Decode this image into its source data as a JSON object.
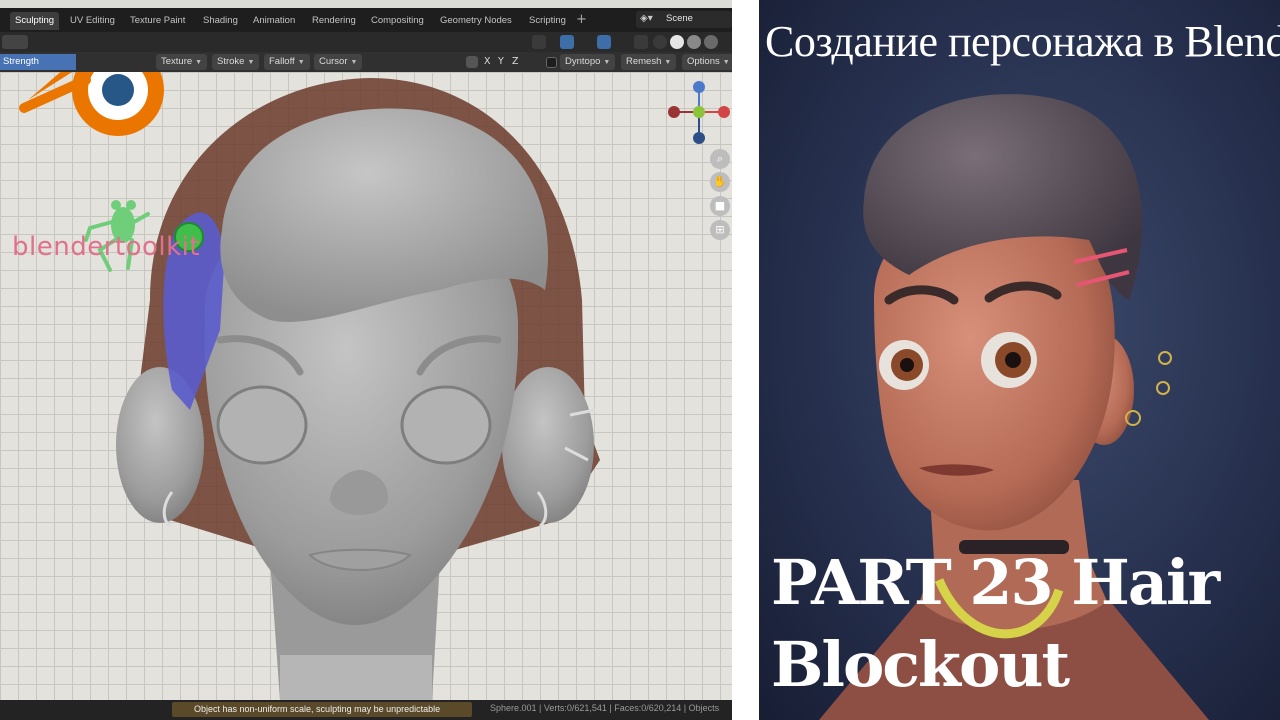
{
  "workspace_tabs": [
    "Sculpting",
    "UV Editing",
    "Texture Paint",
    "Shading",
    "Animation",
    "Rendering",
    "Compositing",
    "Geometry Nodes",
    "Scripting"
  ],
  "active_tab": "Sculpting",
  "scene_label": "Scene",
  "toolbar": {
    "strength_label": "Strength",
    "texture_label": "Texture",
    "stroke_label": "Stroke",
    "falloff_label": "Falloff",
    "cursor_label": "Cursor",
    "axis_x": "X",
    "axis_y": "Y",
    "axis_z": "Z",
    "dyntopo_label": "Dyntopo",
    "remesh_label": "Remesh",
    "options_label": "Options"
  },
  "gizmo": {
    "x": "X",
    "y": "Y",
    "z": "Z"
  },
  "watermark": "blendertoolkit",
  "status": {
    "warning": "Object has non-uniform scale, sculpting may be unpredictable",
    "stats": "Sphere.001 | Verts:0/621,541 | Faces:0/620,214 | Objects"
  },
  "thumbnail": {
    "title": "Создание персонажа в Blender",
    "part_line1": "PART 23 Hair",
    "part_line2": "Blockout"
  },
  "colors": {
    "accent": "#4772b3",
    "blender_orange": "#ea7600",
    "blender_blue": "#265787",
    "watermark_pink": "#e0708c",
    "frog_green": "#6fce7a",
    "mask_blue": "#5a5ccc",
    "sculpt_gray": "#a8a8a8"
  }
}
